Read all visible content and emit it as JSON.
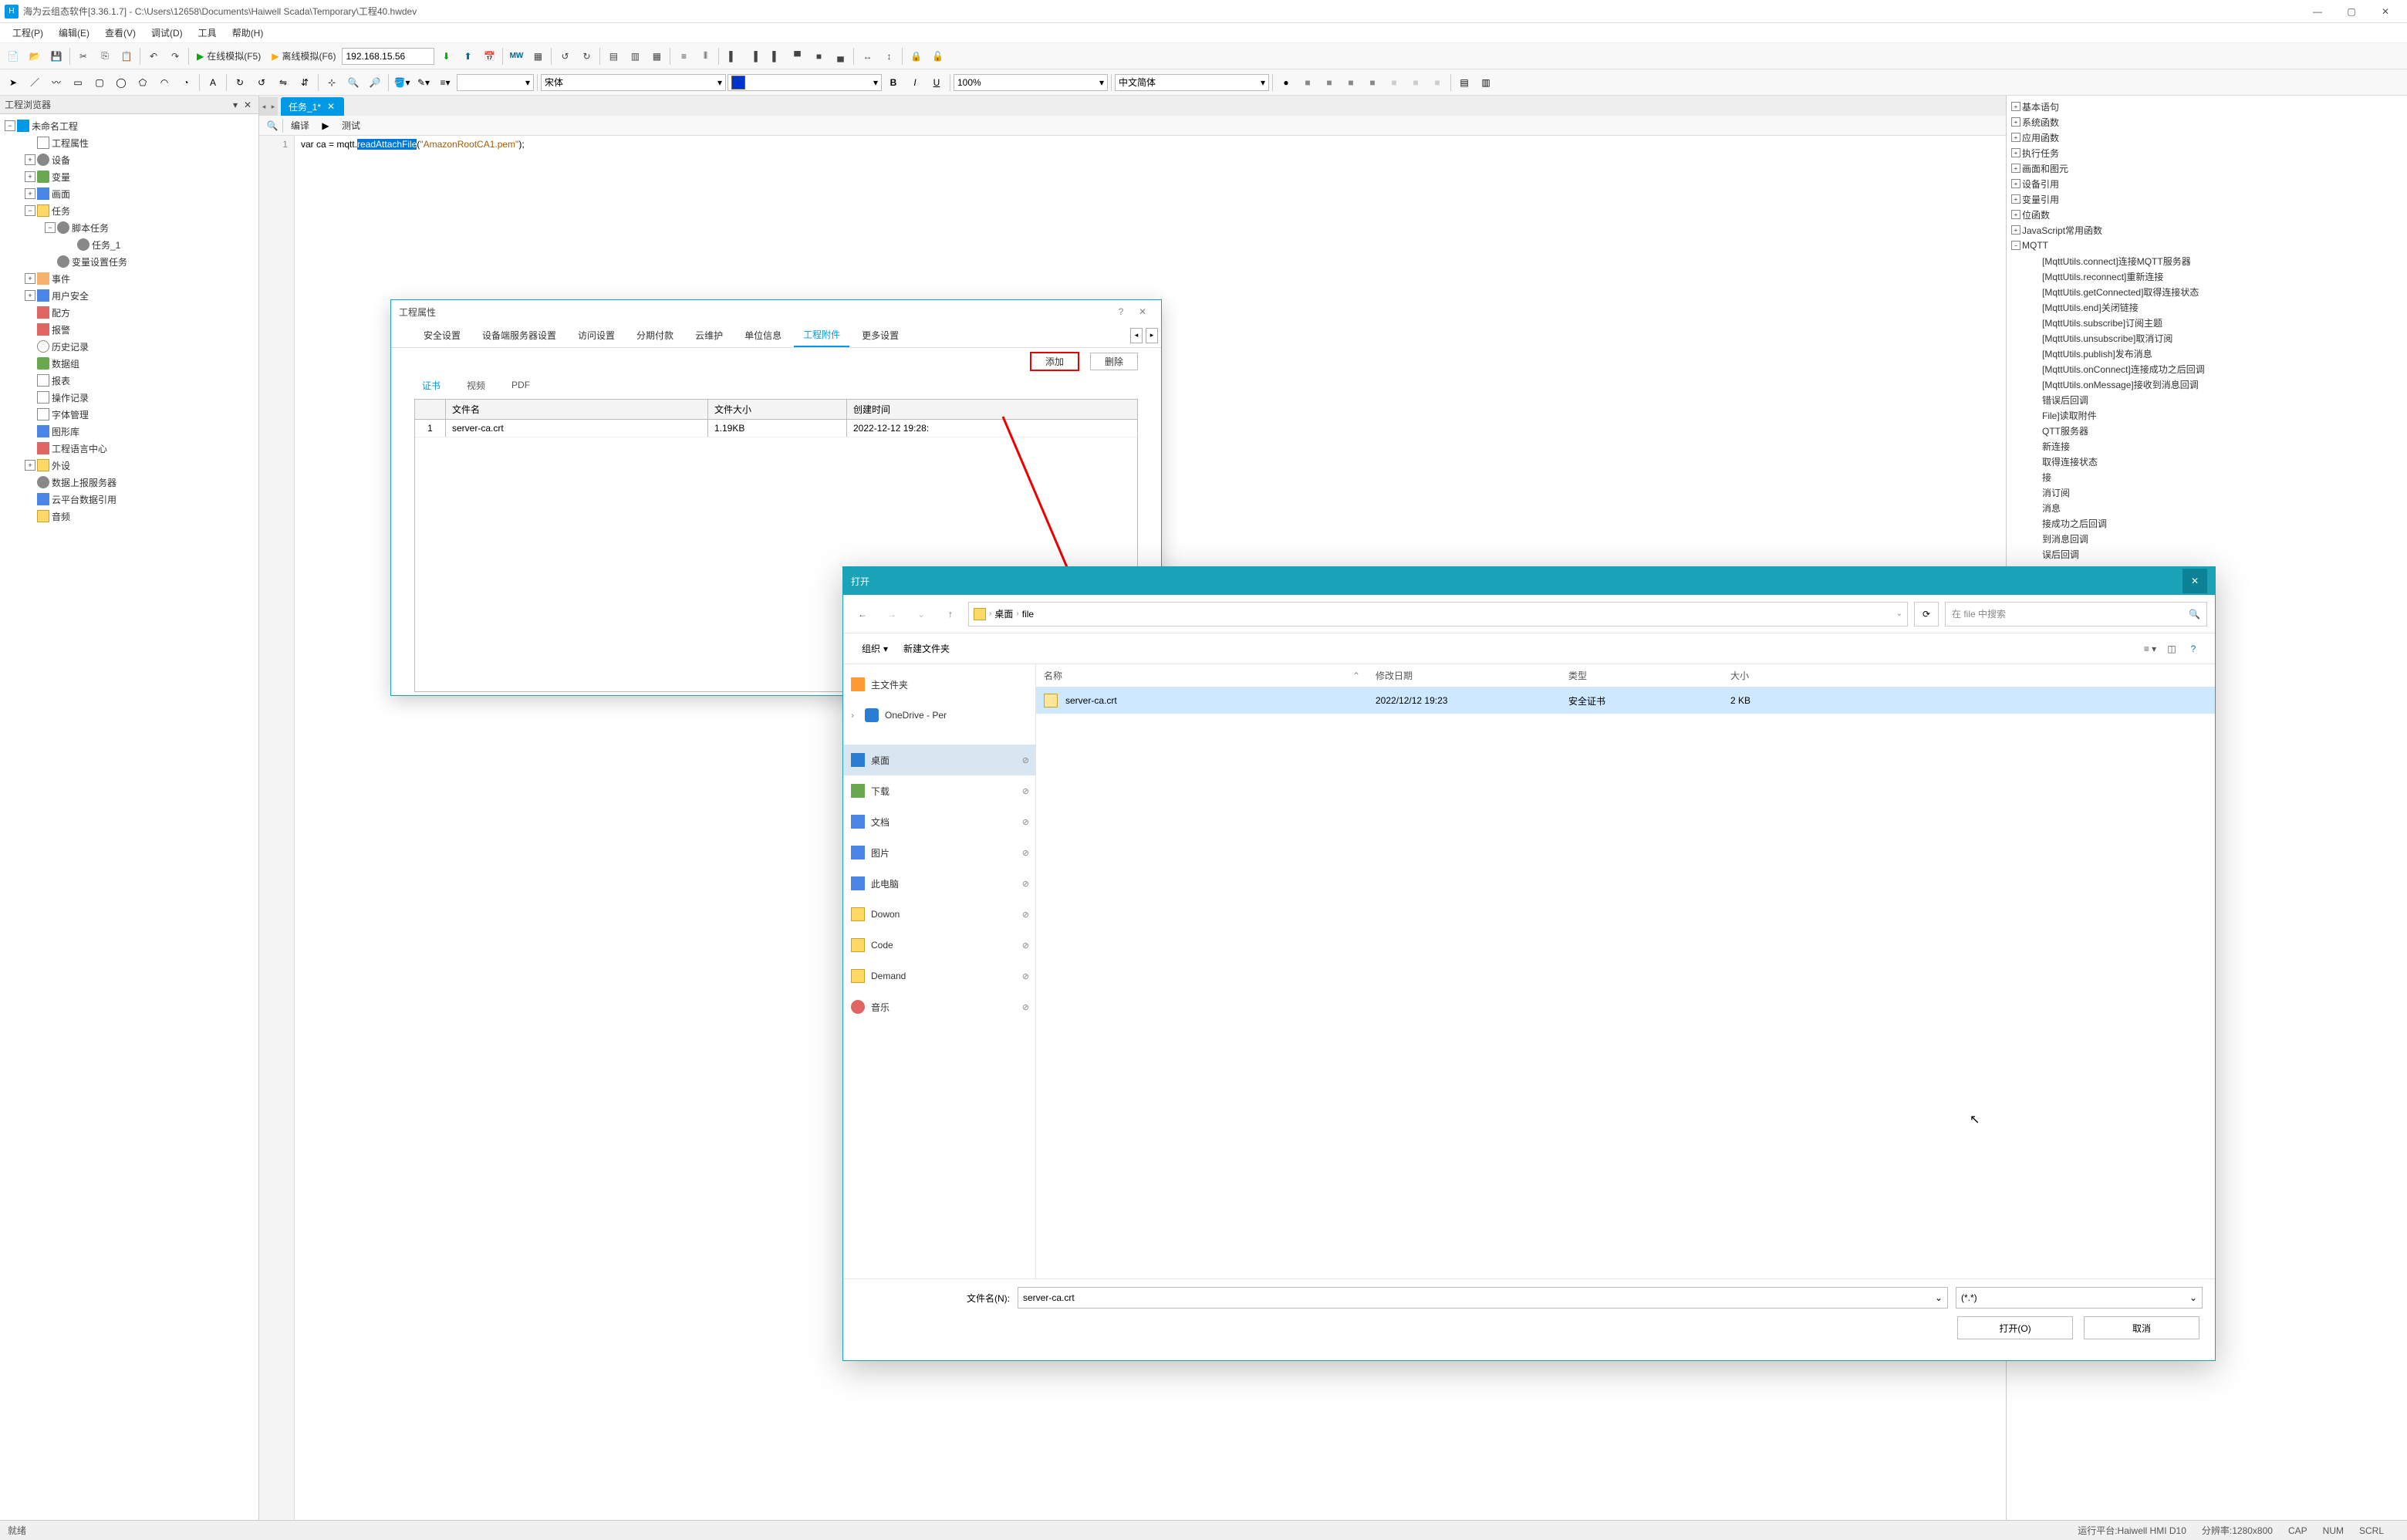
{
  "titlebar": {
    "app": "海为云组态软件[3.36.1.7]",
    "path": "C:\\Users\\12658\\Documents\\Haiwell Scada\\Temporary\\工程40.hwdev"
  },
  "menubar": [
    "工程(P)",
    "编辑(E)",
    "查看(V)",
    "调试(D)",
    "工具",
    "帮助(H)"
  ],
  "toolbar": {
    "online": "在线模拟(F5)",
    "offline": "离线模拟(F6)",
    "ip": "192.168.15.56"
  },
  "toolbar2": {
    "font": "宋体",
    "zoom": "100%",
    "lang": "中文简体"
  },
  "leftpanel": {
    "title": "工程浏览器",
    "tree": {
      "root": "未命名工程",
      "items": [
        "工程属性",
        "设备",
        "变量",
        "画面",
        "任务",
        "事件",
        "用户安全",
        "配方",
        "报警",
        "历史记录",
        "数据组",
        "报表",
        "操作记录",
        "字体管理",
        "图形库",
        "工程语言中心",
        "外设",
        "数据上报服务器",
        "云平台数据引用",
        "音频"
      ],
      "task_children": [
        "脚本任务",
        "变量设置任务"
      ],
      "script_children": [
        "任务_1"
      ]
    }
  },
  "tab": {
    "name": "任务_1*"
  },
  "subtab": {
    "compile": "编译",
    "test": "测试"
  },
  "code": {
    "line1_a": "var ca = mqtt.",
    "line1_func": "readAttachFile",
    "line1_b": "(",
    "line1_str": "\"AmazonRootCA1.pem\"",
    "line1_c": ");"
  },
  "rightpanel": {
    "cats": [
      "基本语句",
      "系统函数",
      "应用函数",
      "执行任务",
      "画面和图元",
      "设备引用",
      "变量引用",
      "位函数",
      "JavaScript常用函数"
    ],
    "mqtt": "MQTT",
    "mqtt_items": [
      "[MqttUtils.connect]连接MQTT服务器",
      "[MqttUtils.reconnect]重新连接",
      "[MqttUtils.getConnected]取得连接状态",
      "[MqttUtils.end]关闭链接",
      "[MqttUtils.subscribe]订阅主题",
      "[MqttUtils.unsubscribe]取消订阅",
      "[MqttUtils.publish]发布消息",
      "[MqttUtils.onConnect]连接成功之后回调",
      "[MqttUtils.onMessage]接收到消息回调",
      "错误后回调",
      "File]读取附件",
      "QTT服务器",
      "新连接",
      "取得连接状态",
      "接",
      "消订阅",
      "消息",
      "接成功之后回调",
      "到消息回调",
      "误后回调"
    ]
  },
  "dlg_engprop": {
    "title": "工程属性",
    "tabs": [
      "安全设置",
      "设备端服务器设置",
      "访问设置",
      "分期付款",
      "云维护",
      "单位信息",
      "工程附件",
      "更多设置"
    ],
    "active_tab": 6,
    "add": "添加",
    "del": "删除",
    "subtabs": [
      "证书",
      "视频",
      "PDF"
    ],
    "active_subtab": 0,
    "cols": [
      "文件名",
      "文件大小",
      "创建时间"
    ],
    "rows": [
      {
        "n": "1",
        "fn": "server-ca.crt",
        "sz": "1.19KB",
        "tm": "2022-12-12 19:28:"
      }
    ]
  },
  "dlg_open": {
    "title": "打开",
    "breadcrumb": [
      "桌面",
      "file"
    ],
    "search_ph": "在 file 中搜索",
    "org": "组织",
    "newf": "新建文件夹",
    "side": [
      {
        "label": "主文件夹",
        "icon": "ic-home"
      },
      {
        "label": "OneDrive - Per",
        "icon": "ic-cloud",
        "expand": true
      },
      {
        "label": "桌面",
        "icon": "ic-desktop",
        "sel": true,
        "pin": true
      },
      {
        "label": "下载",
        "icon": "ic-down",
        "pin": true
      },
      {
        "label": "文档",
        "icon": "ic-doc",
        "pin": true
      },
      {
        "label": "图片",
        "icon": "ic-img",
        "pin": true
      },
      {
        "label": "此电脑",
        "icon": "ic-pc",
        "pin": true
      },
      {
        "label": "Dowon",
        "icon": "ic-folder",
        "pin": true
      },
      {
        "label": "Code",
        "icon": "ic-folder",
        "pin": true
      },
      {
        "label": "Demand",
        "icon": "ic-folder",
        "pin": true
      },
      {
        "label": "音乐",
        "icon": "ic-music",
        "pin": true
      }
    ],
    "cols": [
      "名称",
      "修改日期",
      "类型",
      "大小"
    ],
    "rows": [
      {
        "name": "server-ca.crt",
        "date": "2022/12/12 19:23",
        "type": "安全证书",
        "size": "2 KB",
        "sel": true
      }
    ],
    "fn_label": "文件名(N):",
    "fn_value": "server-ca.crt",
    "filter": "(*.*)",
    "open": "打开(O)",
    "cancel": "取消"
  },
  "statusbar": {
    "ready": "就绪",
    "platform": "运行平台:Haiwell HMI D10",
    "res": "分辨率:1280x800",
    "ind": [
      "CAP",
      "NUM",
      "SCRL"
    ]
  }
}
